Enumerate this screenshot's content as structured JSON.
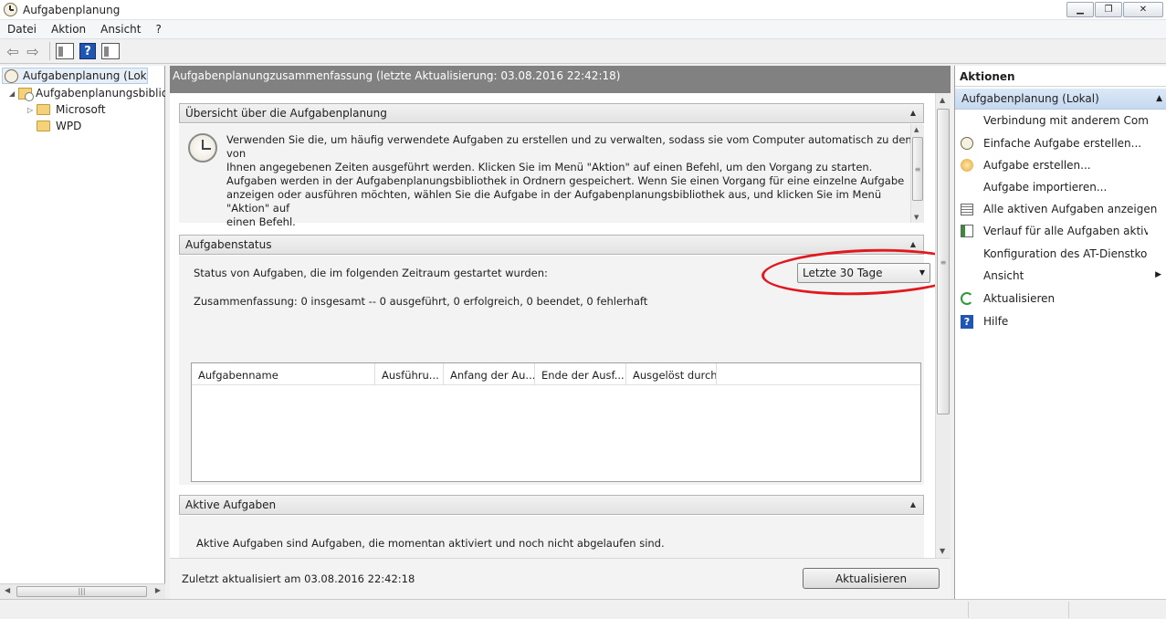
{
  "window": {
    "title": "Aufgabenplanung",
    "minimize_icon": "minimize-icon",
    "restore_icon": "restore-icon",
    "close_icon": "close-icon"
  },
  "menu": [
    "Datei",
    "Aktion",
    "Ansicht",
    "?"
  ],
  "toolbar": {
    "back_icon": "back-arrow-icon",
    "forward_icon": "forward-arrow-icon",
    "show_hide_tree_icon": "console-tree-icon",
    "help_icon": "help-icon",
    "show_hide_actions_icon": "action-pane-icon"
  },
  "tree": {
    "root": "Aufgabenplanung (Lokal)",
    "library": "Aufgabenplanungsbibliothek",
    "children": [
      "Microsoft",
      "WPD"
    ]
  },
  "center": {
    "header": "Aufgabenplanungzusammenfassung (letzte Aktualisierung: 03.08.2016 22:42:18)",
    "overview": {
      "title": "Übersicht über die Aufgabenplanung",
      "para1_line1": "Verwenden Sie die, um häufig verwendete Aufgaben zu erstellen und zu verwalten, sodass sie vom Computer automatisch zu den von",
      "para1_line2": "Ihnen angegebenen Zeiten ausgeführt werden. Klicken Sie im Menü \"Aktion\" auf einen Befehl, um den Vorgang zu starten.",
      "para2_line1": "Aufgaben werden in der Aufgabenplanungsbibliothek in Ordnern gespeichert. Wenn Sie einen Vorgang für eine einzelne Aufgabe",
      "para2_line2": "anzeigen oder ausführen möchten, wählen Sie die Aufgabe in der Aufgabenplanungsbibliothek aus, und klicken Sie im Menü \"Aktion\" auf",
      "para2_line3": "einen Befehl."
    },
    "status": {
      "title": "Aufgabenstatus",
      "range_label": "Status von Aufgaben, die im folgenden Zeitraum gestartet wurden:",
      "range_value": "Letzte 30 Tage",
      "summary": "Zusammenfassung: 0 insgesamt -- 0 ausgeführt, 0 erfolgreich, 0 beendet, 0 fehlerhaft",
      "columns": [
        "Aufgabenname",
        "Ausführu...",
        "Anfang der Au...",
        "Ende der Ausf...",
        "Ausgelöst durch"
      ]
    },
    "active": {
      "title": "Aktive Aufgaben",
      "description": "Aktive Aufgaben sind Aufgaben, die momentan aktiviert und noch nicht abgelaufen sind."
    },
    "footer": {
      "last_updated": "Zuletzt aktualisiert am 03.08.2016 22:42:18",
      "refresh_label": "Aktualisieren"
    }
  },
  "actions": {
    "title": "Aktionen",
    "group": "Aufgabenplanung (Lokal)",
    "items": [
      {
        "label": "Verbindung mit anderem Computer herstellen...",
        "icon": "none"
      },
      {
        "label": "Einfache Aufgabe erstellen...",
        "icon": "basic-task-icon"
      },
      {
        "label": "Aufgabe erstellen...",
        "icon": "create-task-icon"
      },
      {
        "label": "Aufgabe importieren...",
        "icon": "none"
      },
      {
        "label": "Alle aktiven Aufgaben anzeigen",
        "icon": "task-list-icon"
      },
      {
        "label": "Verlauf für alle Aufgaben aktivieren",
        "icon": "history-icon"
      },
      {
        "label": "Konfiguration des AT-Dienstkontos",
        "icon": "none"
      },
      {
        "label": "Ansicht",
        "icon": "none"
      },
      {
        "label": "Aktualisieren",
        "icon": "refresh-icon"
      },
      {
        "label": "Hilfe",
        "icon": "help-icon"
      }
    ]
  },
  "colors": {
    "header_bg": "#818181",
    "highlight_ring": "#e0191f",
    "selection": "#c6d9f0"
  }
}
